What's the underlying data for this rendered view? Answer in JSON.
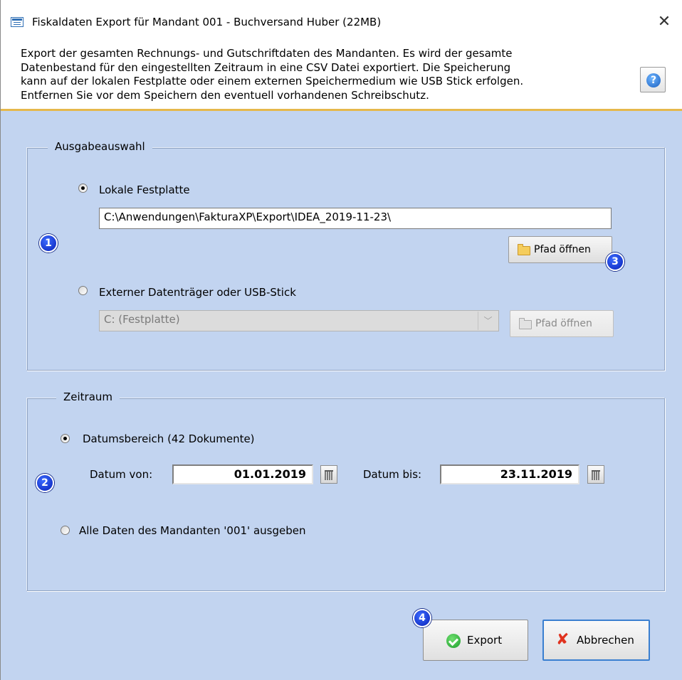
{
  "window": {
    "title": "Fiskaldaten Export für Mandant 001 - Buchversand Huber (22MB)",
    "close_glyph": "✕"
  },
  "info": {
    "text": "Export der gesamten Rechnungs- und Gutschriftdaten des Mandanten. Es wird der gesamte\nDatenbestand für den eingestellten Zeitraum in eine CSV Datei exportiert. Die Speicherung\nkann auf der lokalen Festplatte oder einem externen Speichermedium wie USB Stick erfolgen.\nEntfernen Sie vor dem Speichern den eventuell vorhandenen Schreibschutz.",
    "help_glyph": "?"
  },
  "ausgabe": {
    "group_title": "Ausgabeauswahl",
    "local_label": "Lokale Festplatte",
    "local_selected": true,
    "path_value": "C:\\Anwendungen\\FakturaXP\\Export\\IDEA_2019-11-23\\",
    "open_path_label": "Pfad öffnen",
    "external_label": "Externer Datenträger oder USB-Stick",
    "external_selected": false,
    "drive_value": "C: (Festplatte)",
    "open_path_disabled_label": "Pfad öffnen"
  },
  "zeitraum": {
    "group_title": "Zeitraum",
    "range_label": "Datumsbereich (42 Dokumente)",
    "range_selected": true,
    "date_from_label": "Datum von:",
    "date_from": "01.01.2019",
    "date_to_label": "Datum bis:",
    "date_to": "23.11.2019",
    "all_label": "Alle Daten des Mandanten '001' ausgeben",
    "all_selected": false
  },
  "buttons": {
    "export_label": "Export",
    "cancel_label": "Abbrechen"
  },
  "badges": [
    "1",
    "2",
    "3",
    "4"
  ],
  "colors": {
    "dialog_background": "#c2d4f0",
    "info_border": "#e5b84b",
    "badge_blue": "#0820b8",
    "focus_border": "#3a7fd0"
  }
}
